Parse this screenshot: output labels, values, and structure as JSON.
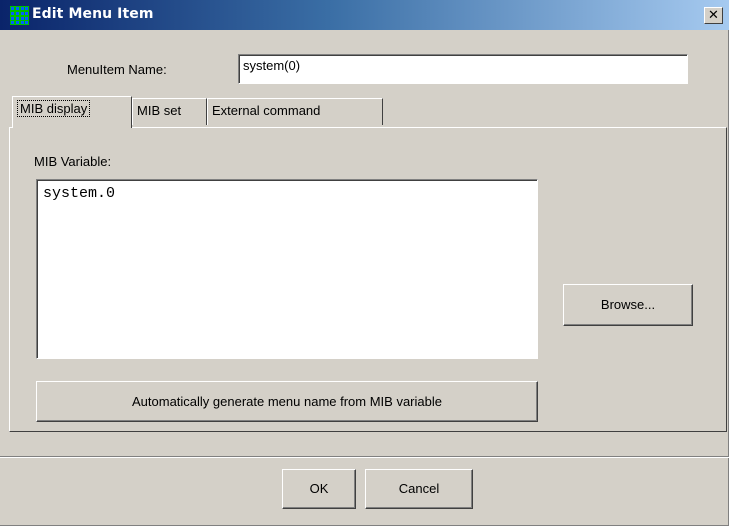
{
  "window": {
    "title": "Edit Menu Item",
    "close_glyph": "✕"
  },
  "form": {
    "menuitem_name_label": "MenuItem Name:",
    "menuitem_name_value": "system(0)"
  },
  "tabs": [
    {
      "label": "MIB display",
      "active": true
    },
    {
      "label": "MIB set",
      "active": false
    },
    {
      "label": "External command",
      "active": false
    }
  ],
  "mib_display": {
    "variable_label": "MIB Variable:",
    "variable_value": "system.0",
    "browse_label": "Browse...",
    "autogen_label": "Automatically generate menu name from MIB variable"
  },
  "footer": {
    "ok_label": "OK",
    "cancel_label": "Cancel"
  },
  "icons": {
    "title": "grid-app-icon",
    "close": "close-icon"
  },
  "colors": {
    "titlebar_start": "#0a246a",
    "titlebar_end": "#a6caf0",
    "face": "#d4d0c8"
  }
}
